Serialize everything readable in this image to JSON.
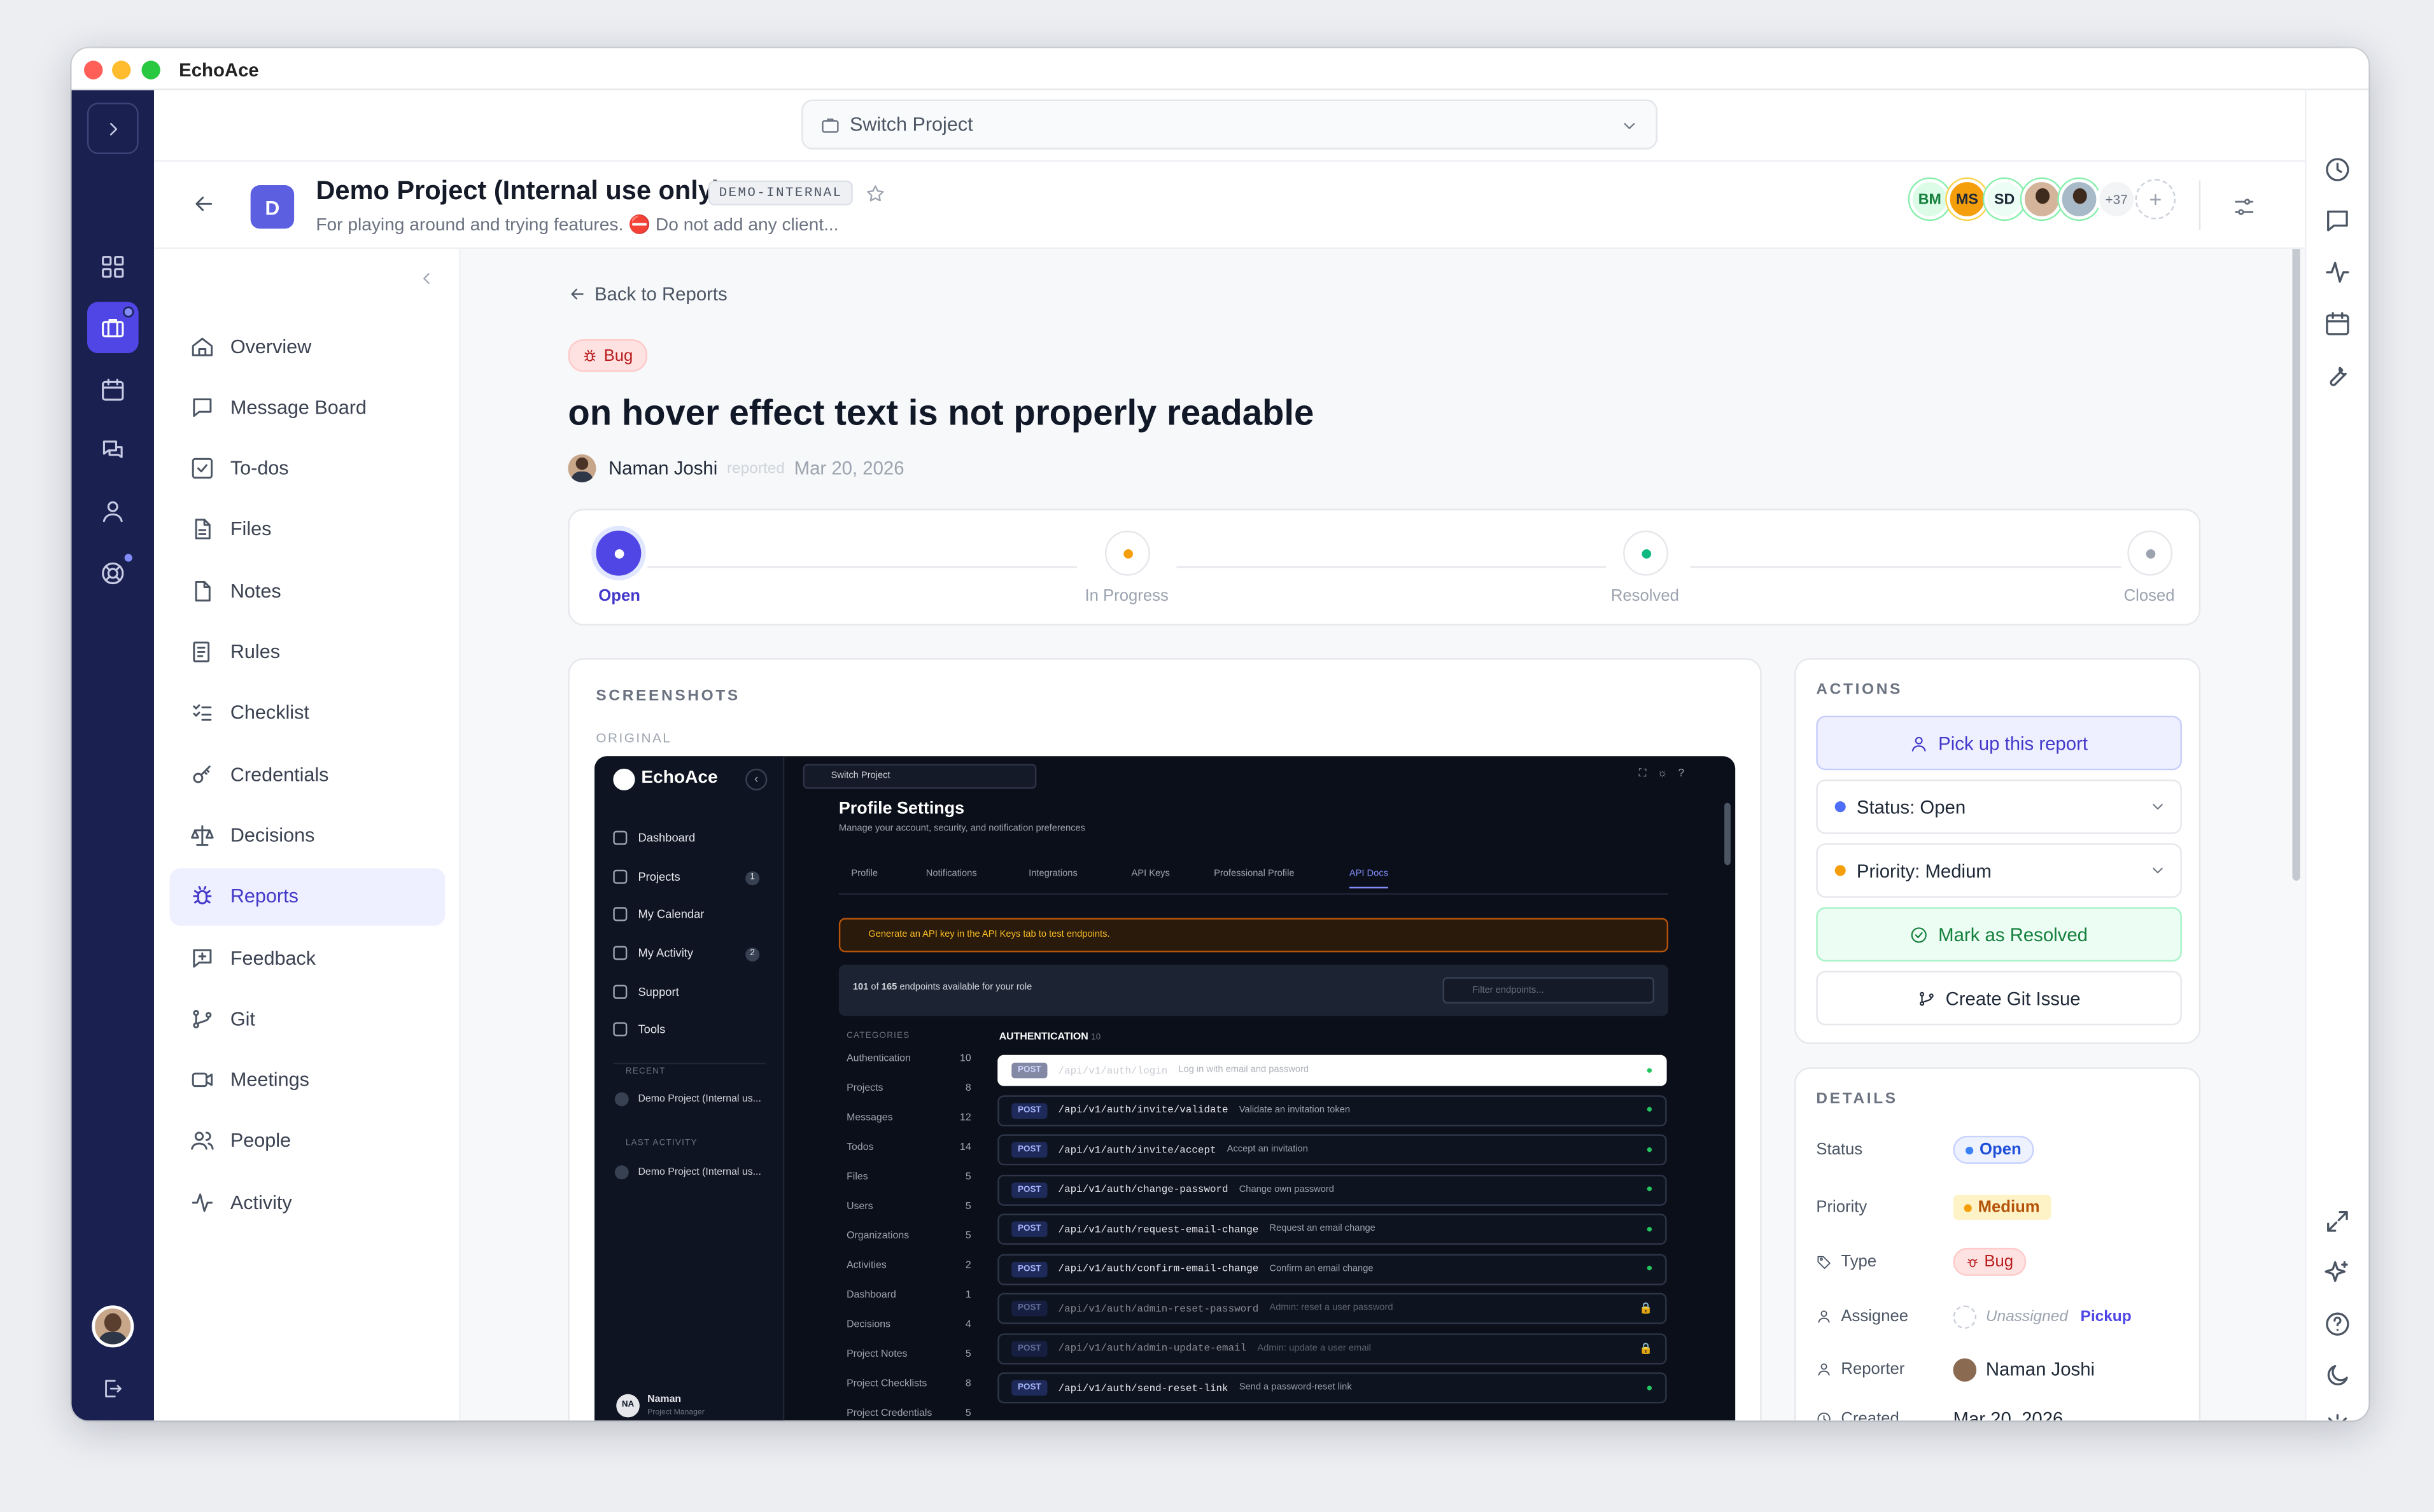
{
  "window": {
    "title": "EchoAce"
  },
  "topbar": {
    "switch_label": "Switch Project"
  },
  "project": {
    "initial": "D",
    "name": "Demo Project (Internal use only)",
    "code": "DEMO-INTERNAL",
    "description": "For playing around and trying features. ⛔ Do not add any client...",
    "members": [
      "BM",
      "MS",
      "SD"
    ],
    "more_members": "+37"
  },
  "nav": [
    {
      "label": "Overview",
      "icon": "home-icon"
    },
    {
      "label": "Message Board",
      "icon": "message-icon"
    },
    {
      "label": "To-dos",
      "icon": "checkbox-icon"
    },
    {
      "label": "Files",
      "icon": "file-icon"
    },
    {
      "label": "Notes",
      "icon": "note-icon"
    },
    {
      "label": "Rules",
      "icon": "rules-icon"
    },
    {
      "label": "Checklist",
      "icon": "checklist-icon"
    },
    {
      "label": "Credentials",
      "icon": "key-icon"
    },
    {
      "label": "Decisions",
      "icon": "scale-icon"
    },
    {
      "label": "Reports",
      "icon": "bug-icon",
      "active": true
    },
    {
      "label": "Feedback",
      "icon": "feedback-icon"
    },
    {
      "label": "Git",
      "icon": "git-icon"
    },
    {
      "label": "Meetings",
      "icon": "video-icon"
    },
    {
      "label": "People",
      "icon": "people-icon"
    },
    {
      "label": "Activity",
      "icon": "activity-icon"
    }
  ],
  "report": {
    "back_label": "Back to Reports",
    "type_badge": "Bug",
    "title": "on hover effect text is not properly readable",
    "author": "Naman Joshi",
    "reported_word": "reported",
    "date": "Mar 20, 2026"
  },
  "progress": {
    "steps": [
      "Open",
      "In Progress",
      "Resolved",
      "Closed"
    ],
    "current": "Open"
  },
  "screenshots": {
    "heading": "SCREENSHOTS",
    "original_label": "ORIGINAL"
  },
  "actions": {
    "heading": "ACTIONS",
    "pickup": "Pick up this report",
    "status": "Status: Open",
    "priority": "Priority: Medium",
    "resolve": "Mark as Resolved",
    "git_issue": "Create Git Issue"
  },
  "details": {
    "heading": "DETAILS",
    "status_label": "Status",
    "status_value": "Open",
    "priority_label": "Priority",
    "priority_value": "Medium",
    "type_label": "Type",
    "type_value": "Bug",
    "assignee_label": "Assignee",
    "assignee_value": "Unassigned",
    "assignee_action": "Pickup",
    "reporter_label": "Reporter",
    "reporter_value": "Naman Joshi",
    "created_label": "Created",
    "created_value": "Mar 20, 2026"
  },
  "inner_app": {
    "logo": "EchoAce",
    "switch_label": "Switch Project",
    "nav": [
      "Dashboard",
      "Projects",
      "My Calendar",
      "My Activity",
      "Support",
      "Tools"
    ],
    "projects_badge": "1",
    "activity_badge": "2",
    "recent_heading": "RECENT",
    "recent_item": "Demo Project (Internal us...",
    "last_activity_heading": "LAST ACTIVITY",
    "last_activity_item": "Demo Project (Internal us...",
    "user_initials": "NA",
    "user_name": "Naman",
    "user_role": "Project Manager",
    "page_title": "Profile Settings",
    "page_subtitle": "Manage your account, security, and notification preferences",
    "tabs": [
      "Profile",
      "Notifications",
      "Integrations",
      "API Keys",
      "Professional Profile",
      "API Docs"
    ],
    "warning": "Generate an API key in the API Keys tab to test endpoints.",
    "count_bold": "101",
    "count_of": "of",
    "count_total": "165",
    "count_suffix": "endpoints available for your role",
    "filter_placeholder": "Filter endpoints...",
    "categories_heading": "CATEGORIES",
    "categories": [
      {
        "name": "Authentication",
        "count": "10"
      },
      {
        "name": "Projects",
        "count": "8"
      },
      {
        "name": "Messages",
        "count": "12"
      },
      {
        "name": "Todos",
        "count": "14"
      },
      {
        "name": "Files",
        "count": "5"
      },
      {
        "name": "Users",
        "count": "5"
      },
      {
        "name": "Organizations",
        "count": "5"
      },
      {
        "name": "Activities",
        "count": "2"
      },
      {
        "name": "Dashboard",
        "count": "1"
      },
      {
        "name": "Decisions",
        "count": "4"
      },
      {
        "name": "Project Notes",
        "count": "5"
      },
      {
        "name": "Project Checklists",
        "count": "8"
      },
      {
        "name": "Project Credentials",
        "count": "5"
      }
    ],
    "section_heading": "AUTHENTICATION",
    "section_count": "10",
    "endpoints": [
      {
        "method": "POST",
        "path": "/api/v1/auth/login",
        "desc": "Log in with email and password"
      },
      {
        "method": "POST",
        "path": "/api/v1/auth/invite/validate",
        "desc": "Validate an invitation token"
      },
      {
        "method": "POST",
        "path": "/api/v1/auth/invite/accept",
        "desc": "Accept an invitation"
      },
      {
        "method": "POST",
        "path": "/api/v1/auth/change-password",
        "desc": "Change own password"
      },
      {
        "method": "POST",
        "path": "/api/v1/auth/request-email-change",
        "desc": "Request an email change"
      },
      {
        "method": "POST",
        "path": "/api/v1/auth/confirm-email-change",
        "desc": "Confirm an email change"
      },
      {
        "method": "POST",
        "path": "/api/v1/auth/admin-reset-password",
        "desc": "Admin: reset a user password"
      },
      {
        "method": "POST",
        "path": "/api/v1/auth/admin-update-email",
        "desc": "Admin: update a user email"
      },
      {
        "method": "POST",
        "path": "/api/v1/auth/send-reset-link",
        "desc": "Send a password-reset link"
      }
    ]
  },
  "colors": {
    "accent": "#4f46e5",
    "rail": "#1a2050",
    "green": "#16a34a",
    "amber": "#f59e0b",
    "red": "#dc2626"
  }
}
